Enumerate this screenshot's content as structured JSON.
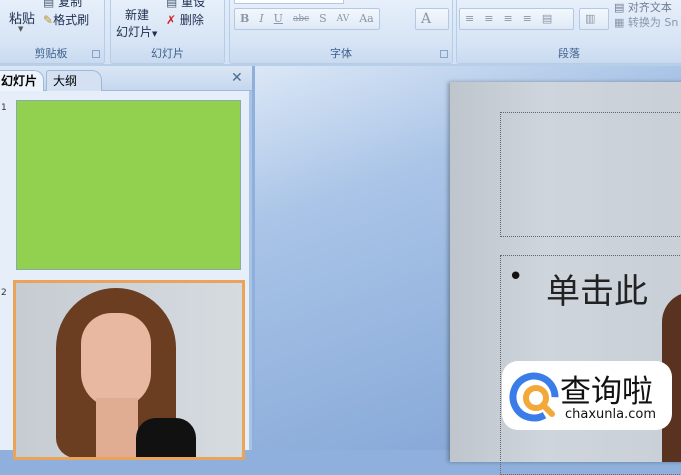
{
  "ribbon": {
    "clipboard": {
      "label": "剪贴板",
      "paste": "粘贴",
      "copy": "复制",
      "format_painter": "格式刷"
    },
    "slides": {
      "label": "幻灯片",
      "new_slide_line1": "新建",
      "new_slide_line2": "幻灯片",
      "reset": "重设",
      "delete": "删除"
    },
    "font": {
      "label": "字体",
      "buttons": [
        "B",
        "I",
        "U",
        "abc",
        "S",
        "AV",
        "Aa",
        "A"
      ]
    },
    "paragraph": {
      "label": "段落",
      "text_direction": "对齐文本",
      "convert_smartart": "转换为 Sn"
    }
  },
  "left_panel": {
    "tabs": [
      "幻灯片",
      "大纲"
    ],
    "close": "✕",
    "slide_numbers": [
      "1",
      "2"
    ],
    "slide1_color": "#92d050"
  },
  "slide": {
    "bullet": "•",
    "content_placeholder": "单击此"
  },
  "watermark": {
    "name": "查询啦",
    "url": "chaxunla.com"
  }
}
